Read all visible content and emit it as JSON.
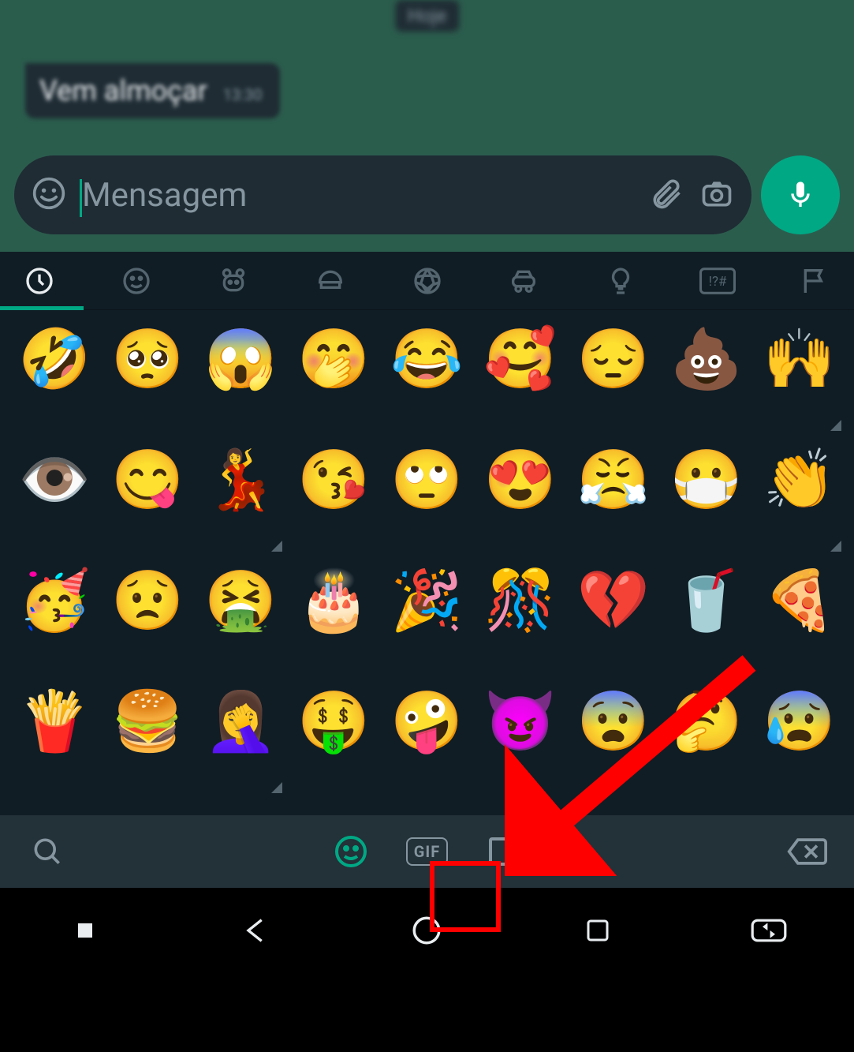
{
  "date_chip": "Hoje",
  "message": {
    "text": "Vem almoçar",
    "time": "13:30"
  },
  "input": {
    "placeholder": "Mensagem"
  },
  "categories": [
    {
      "name": "recent",
      "active": true
    },
    {
      "name": "smileys",
      "active": false
    },
    {
      "name": "animals",
      "active": false
    },
    {
      "name": "food",
      "active": false
    },
    {
      "name": "activity",
      "active": false
    },
    {
      "name": "travel",
      "active": false
    },
    {
      "name": "objects",
      "active": false
    },
    {
      "name": "symbols",
      "active": false
    },
    {
      "name": "flags",
      "active": false
    }
  ],
  "emojis": [
    {
      "g": "🤣"
    },
    {
      "g": "🥺"
    },
    {
      "g": "😱"
    },
    {
      "g": "🤭"
    },
    {
      "g": "😂"
    },
    {
      "g": "🥰"
    },
    {
      "g": "😔"
    },
    {
      "g": "💩"
    },
    {
      "g": "🙌",
      "tone": true
    },
    {
      "g": "👁️"
    },
    {
      "g": "😋"
    },
    {
      "g": "💃",
      "tone": true
    },
    {
      "g": "😘"
    },
    {
      "g": "🙄"
    },
    {
      "g": "😍"
    },
    {
      "g": "😤"
    },
    {
      "g": "😷"
    },
    {
      "g": "👏",
      "tone": true
    },
    {
      "g": "🥳"
    },
    {
      "g": "😟"
    },
    {
      "g": "🤮"
    },
    {
      "g": "🎂"
    },
    {
      "g": "🎉"
    },
    {
      "g": "🎊"
    },
    {
      "g": "💔"
    },
    {
      "g": "🥤"
    },
    {
      "g": "🍕"
    },
    {
      "g": "🍟"
    },
    {
      "g": "🍔"
    },
    {
      "g": "🤦‍♀️",
      "tone": true
    },
    {
      "g": "🤑"
    },
    {
      "g": "🤪"
    },
    {
      "g": "😈"
    },
    {
      "g": "😨"
    },
    {
      "g": "🤔"
    },
    {
      "g": "😰"
    }
  ],
  "bottom_bar": {
    "gif_label": "GIF"
  },
  "highlight": {
    "target": "sticker-tab"
  }
}
